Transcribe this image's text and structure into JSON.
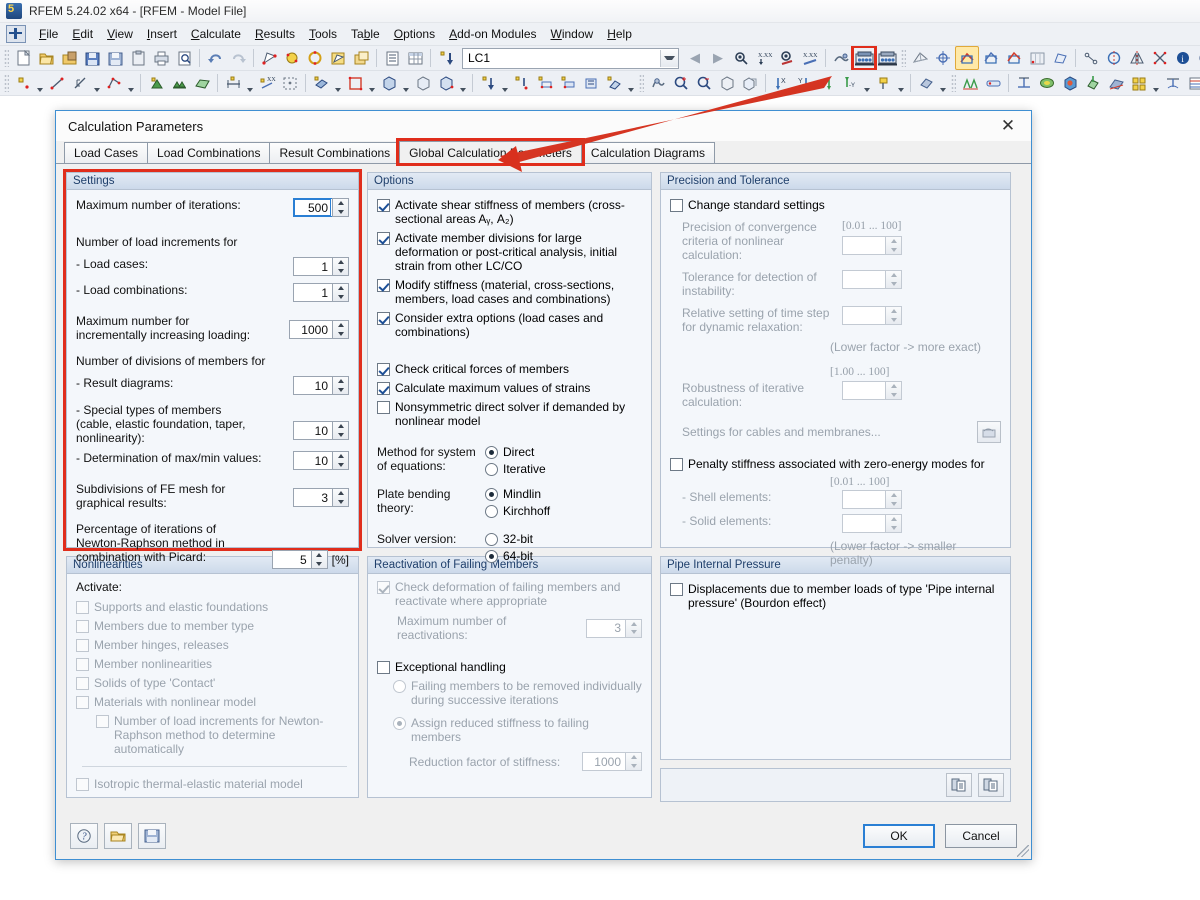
{
  "window": {
    "title": "RFEM 5.24.02 x64 - [RFEM - Model File]",
    "logo_icon": "rfem-logo-icon"
  },
  "menubar": {
    "items": [
      {
        "label": "File",
        "accel": "F"
      },
      {
        "label": "Edit",
        "accel": "E"
      },
      {
        "label": "View",
        "accel": "V"
      },
      {
        "label": "Insert",
        "accel": "I"
      },
      {
        "label": "Calculate",
        "accel": "C"
      },
      {
        "label": "Results",
        "accel": "R"
      },
      {
        "label": "Tools",
        "accel": "T"
      },
      {
        "label": "Table",
        "accel": "b"
      },
      {
        "label": "Options",
        "accel": "O"
      },
      {
        "label": "Add-on Modules",
        "accel": "A"
      },
      {
        "label": "Window",
        "accel": "W"
      },
      {
        "label": "Help",
        "accel": "H"
      }
    ]
  },
  "toolbar": {
    "load_case_value": "LC1",
    "load_case_placeholder": "LC1",
    "highlighted_button": "calculate-all-icon"
  },
  "dialog": {
    "title": "Calculation Parameters",
    "close_label": "✕",
    "tabs": [
      {
        "label": "Load Cases",
        "selected": false
      },
      {
        "label": "Load Combinations",
        "selected": false
      },
      {
        "label": "Result Combinations",
        "selected": false
      },
      {
        "label": "Global Calculation Parameters",
        "selected": true,
        "marked": true
      },
      {
        "label": "Calculation Diagrams",
        "selected": false
      }
    ],
    "footer": {
      "help_icon": "help-icon",
      "open_icon": "open-folder-icon",
      "save_icon": "save-floppy-icon",
      "ok_label": "OK",
      "cancel_label": "Cancel"
    }
  },
  "settings": {
    "header": "Settings",
    "max_iterations_label": "Maximum number of iterations:",
    "max_iterations_value": "500",
    "load_increments_header": "Number of load increments for",
    "load_cases_label": "- Load cases:",
    "load_cases_value": "1",
    "load_combinations_label": "- Load combinations:",
    "load_combinations_value": "1",
    "max_incremental_label": "Maximum number for incrementally increasing loading:",
    "max_incremental_value": "1000",
    "divisions_header": "Number of divisions of members for",
    "result_diagrams_label": "- Result diagrams:",
    "result_diagrams_value": "10",
    "special_types_label": "- Special types of members (cable, elastic foundation, taper, nonlinearity):",
    "special_types_value": "10",
    "maxmin_label": "- Determination of max/min values:",
    "maxmin_value": "10",
    "fe_mesh_label": "Subdivisions of FE mesh for graphical results:",
    "fe_mesh_value": "3",
    "picard_label": "Percentage of iterations of Newton-Raphson method in combination with Picard:",
    "picard_value": "5",
    "picard_unit": "[%]"
  },
  "nonlinearities": {
    "header": "Nonlinearities",
    "activate_label": "Activate:",
    "items": [
      {
        "label": "Supports and elastic foundations",
        "checked": false,
        "disabled": true
      },
      {
        "label": "Members due to member type",
        "checked": false,
        "disabled": true
      },
      {
        "label": "Member hinges, releases",
        "checked": false,
        "disabled": true
      },
      {
        "label": "Member nonlinearities",
        "checked": false,
        "disabled": true
      },
      {
        "label": "Solids of type 'Contact'",
        "checked": false,
        "disabled": true
      },
      {
        "label": "Materials with nonlinear model",
        "checked": false,
        "disabled": true
      }
    ],
    "sub_item": {
      "label": "Number of load increments for Newton-Raphson method to determine automatically",
      "checked": false,
      "disabled": true
    },
    "isotropic": {
      "label": "Isotropic thermal-elastic material model",
      "checked": false,
      "disabled": true
    }
  },
  "options": {
    "header": "Options",
    "checkboxes": [
      {
        "label": "Activate shear stiffness of members (cross-sectional areas Aᵧ, A₂)",
        "checked": true
      },
      {
        "label": "Activate member divisions for large deformation or post-critical analysis, initial strain from other LC/CO",
        "checked": true
      },
      {
        "label": "Modify stiffness (material, cross-sections, members, load cases and combinations)",
        "checked": true
      },
      {
        "label": "Consider extra options (load cases and combinations)",
        "checked": true
      },
      {
        "label": "Check critical forces of members",
        "checked": true
      },
      {
        "label": "Calculate maximum values of strains",
        "checked": true
      },
      {
        "label": "Nonsymmetric direct solver if demanded by nonlinear model",
        "checked": false
      }
    ],
    "method_label": "Method for system of equations:",
    "method_options": [
      {
        "label": "Direct",
        "selected": true
      },
      {
        "label": "Iterative",
        "selected": false
      }
    ],
    "plate_label": "Plate bending theory:",
    "plate_options": [
      {
        "label": "Mindlin",
        "selected": true
      },
      {
        "label": "Kirchhoff",
        "selected": false
      }
    ],
    "solver_label": "Solver version:",
    "solver_options": [
      {
        "label": "32-bit",
        "selected": false
      },
      {
        "label": "64-bit",
        "selected": true
      }
    ]
  },
  "reactivation": {
    "header": "Reactivation of Failing Members",
    "check_deformation": {
      "label": "Check deformation of failing members and reactivate where appropriate",
      "checked": true,
      "disabled": true
    },
    "max_reactivations_label": "Maximum number of reactivations:",
    "max_reactivations_value": "3",
    "exceptional": {
      "label": "Exceptional handling",
      "checked": false
    },
    "radio_remove": {
      "label": "Failing members to be removed individually during successive iterations",
      "selected": false,
      "disabled": true
    },
    "radio_reduced": {
      "label": "Assign reduced stiffness to failing members",
      "selected": true,
      "disabled": true
    },
    "reduction_label": "Reduction factor of stiffness:",
    "reduction_value": "1000"
  },
  "precision": {
    "header": "Precision and Tolerance",
    "change_standard": {
      "label": "Change standard settings",
      "checked": false
    },
    "convergence_label": "Precision of convergence criteria of nonlinear calculation:",
    "convergence_range": "[0.01 ... 100]",
    "convergence_value": "",
    "instability_label": "Tolerance for detection of instability:",
    "instability_value": "",
    "timestep_label": "Relative setting of time step for dynamic relaxation:",
    "timestep_value": "",
    "timestep_note": "(Lower factor -> more exact)",
    "robustness_range": "[1.00 ... 100]",
    "robustness_label": "Robustness of iterative calculation:",
    "robustness_value": "",
    "cables_label": "Settings for cables and membranes...",
    "cables_icon": "cable-settings-icon",
    "penalty": {
      "label": "Penalty stiffness associated with zero-energy modes for",
      "checked": false
    },
    "penalty_range": "[0.01 ... 100]",
    "shell_label": "- Shell elements:",
    "shell_value": "",
    "solid_label": "- Solid elements:",
    "solid_value": "",
    "penalty_note": "(Lower factor -> smaller penalty)"
  },
  "pipe": {
    "header": "Pipe Internal Pressure",
    "displacement": {
      "label": "Displacements due to member loads of type 'Pipe internal pressure' (Bourdon effect)",
      "checked": false
    },
    "copy_icon_1": "copy-settings-icon",
    "copy_icon_2": "paste-settings-icon"
  },
  "annotation": {
    "accent_color": "#e02d1b",
    "arrow": "arrow-pointing-to-global-calculation-parameters-tab"
  }
}
